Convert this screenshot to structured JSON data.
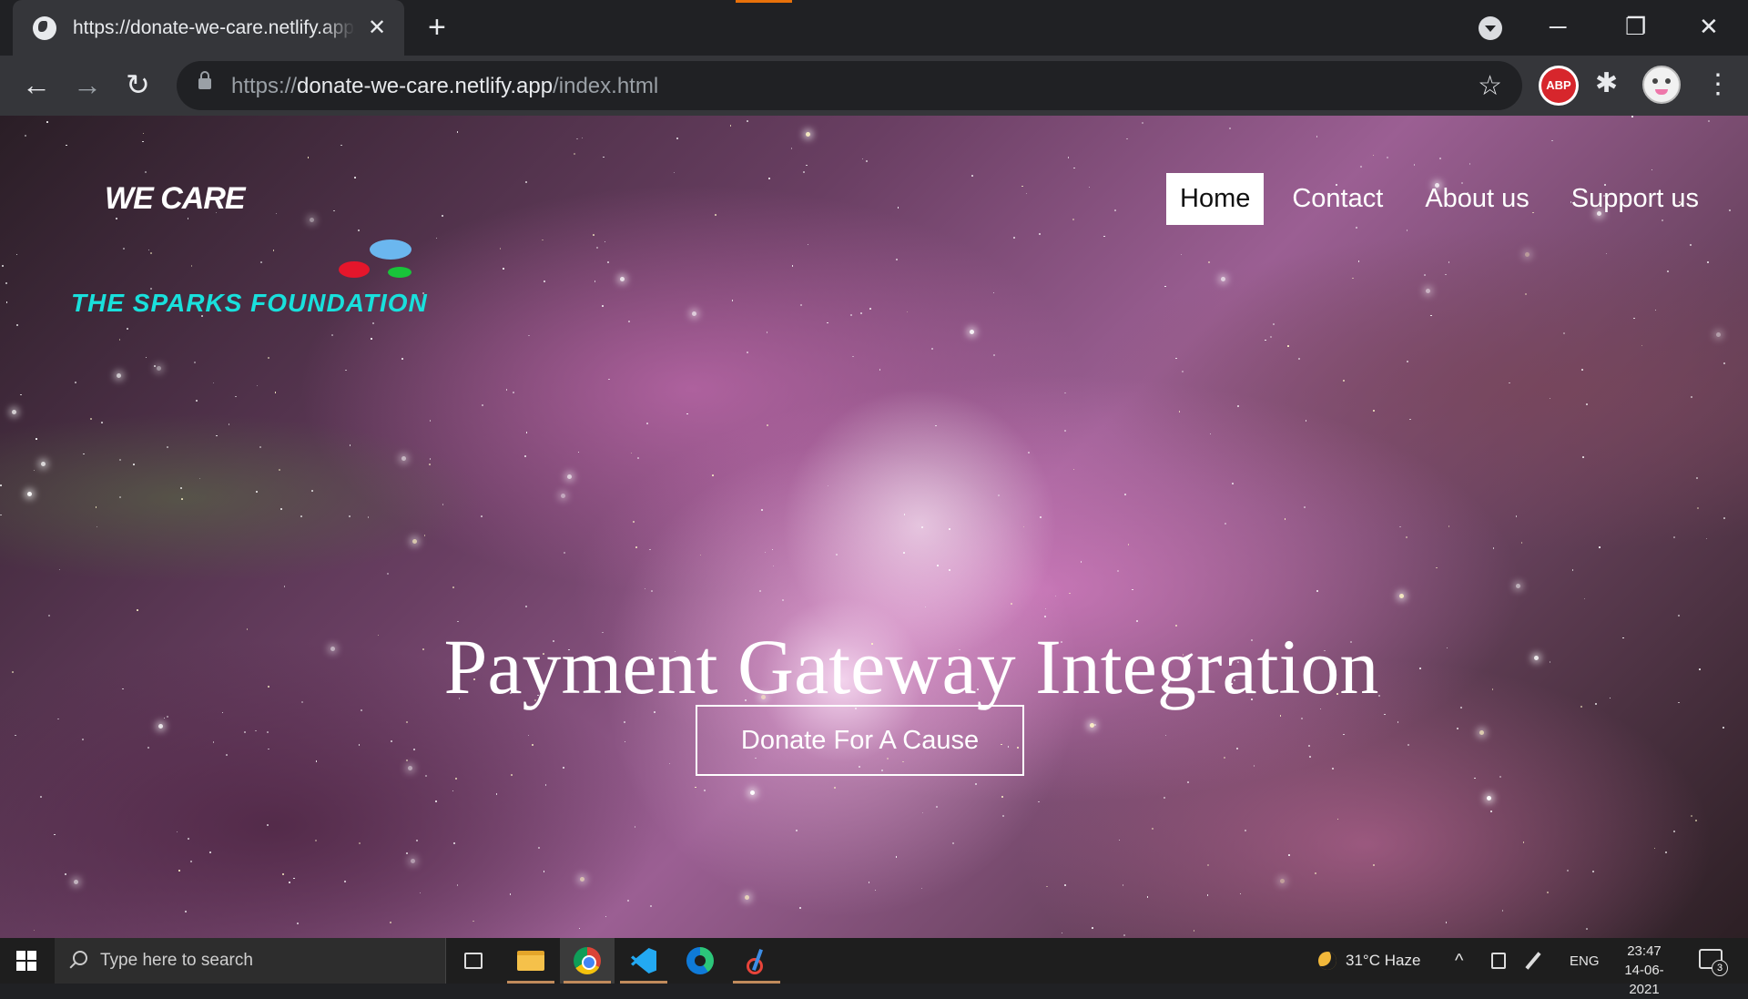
{
  "browser": {
    "tab_title": "https://donate-we-care.netlify.app/index.html",
    "tab_close": "✕",
    "new_tab": "+",
    "url_scheme": "https://",
    "url_host": "donate-we-care.netlify.app",
    "url_path": "/index.html",
    "back": "←",
    "forward": "→",
    "reload": "↻",
    "bookmark": "☆",
    "abp_label": "ABP",
    "extensions": "✱",
    "menu": "⋮",
    "minimize": "─",
    "restore": "❐",
    "close": "✕"
  },
  "site": {
    "brand": "WE CARE",
    "partner": "THE SPARKS FOUNDATION",
    "nav": [
      "Home",
      "Contact",
      "About us",
      "Support us"
    ],
    "active_nav": "Home",
    "hero_title": "Payment Gateway Integration",
    "hero_button": "Donate For A Cause"
  },
  "taskbar": {
    "search_placeholder": "Type here to search",
    "weather": "31°C  Haze",
    "language": "ENG",
    "time": "23:47",
    "date": "14-06-2021",
    "notification_count": "3",
    "tray_up": "^"
  },
  "colors": {
    "partner_text": "#19e0dc",
    "logo_blue": "#6bb7ef",
    "logo_red": "#e5162b",
    "logo_green": "#19c43a",
    "abp_red": "#d7262c"
  }
}
